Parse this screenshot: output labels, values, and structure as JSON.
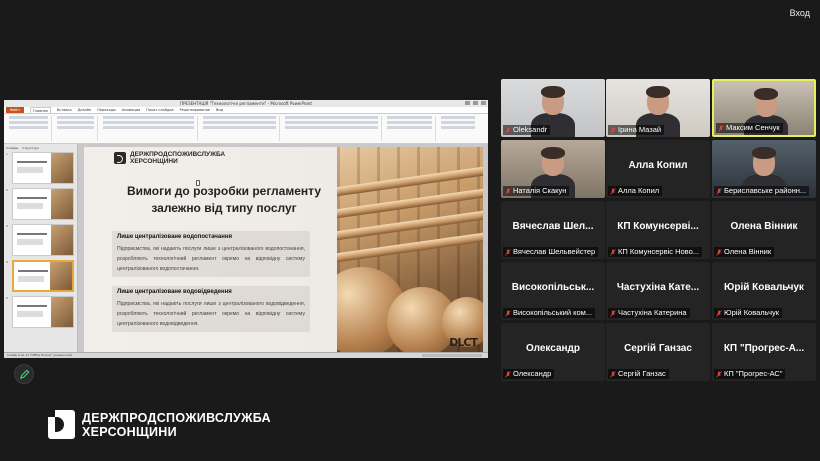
{
  "header": {
    "exit_label": "Вход"
  },
  "powerpoint": {
    "title": "ПРЕЗЕНТАЦІЯ \"Технологічні регламенти\" - Microsoft PowerPoint",
    "tabs": [
      "Файл",
      "Главная",
      "Вставка",
      "Дизайн",
      "Переходы",
      "Анимация",
      "Показ слайдов",
      "Рецензирование",
      "Вид"
    ],
    "thumb_tabs": [
      "Слайды",
      "Структура"
    ],
    "status": "Слайд 4 из 11  \"Office theme\"  украинский"
  },
  "slide": {
    "org_name_line1": "ДЕРЖПРОДСПОЖИВСЛУЖБА",
    "org_name_line2": "ХЕРСОНЩИНИ",
    "title": "Вимоги до розробки регламенту залежно від типу послуг",
    "cards": [
      {
        "heading": "Лише централізоване водопостачання",
        "text": "Підприємства, які надають послуги лише з централізованого водопостачання, розробляють технологічний регламент окремо на відповідну систему централізованого водопостачання."
      },
      {
        "heading": "Лише централізоване водовідведення",
        "text": "Підприємства, які надають послуги лише з централізованого водовідведення, розробляють технологічний регламент окремо на відповідну систему централізованого водовідведення."
      }
    ],
    "watermark": "DLCT"
  },
  "brand": {
    "line1": "ДЕРЖПРОДСПОЖИВСЛУЖБА",
    "line2": "ХЕРСОНЩИНИ"
  },
  "participants": [
    {
      "label": "Oleksandr",
      "big": "",
      "video": true
    },
    {
      "label": "Ірина Мазай",
      "big": "",
      "video": true
    },
    {
      "label": "Максим Сенчук",
      "big": "",
      "video": true,
      "speaking": true
    },
    {
      "label": "Наталія Скакун",
      "big": "",
      "video": true
    },
    {
      "label": "Алла Копил",
      "big": "Алла Копил",
      "video": false
    },
    {
      "label": "Бериславське районн...",
      "big": "",
      "video": true
    },
    {
      "label": "Вячеслав Шельвейстер",
      "big": "Вячеслав Шел...",
      "video": false
    },
    {
      "label": "КП Комунсервіс Ново...",
      "big": "КП Комунсерві...",
      "video": false
    },
    {
      "label": "Олена Вінник",
      "big": "Олена Вінник",
      "video": false
    },
    {
      "label": "Високопільський ком...",
      "big": "Високопільськ...",
      "video": false
    },
    {
      "label": "Частухіна Катерина",
      "big": "Частухіна Кате...",
      "video": false
    },
    {
      "label": "Юрій Ковальчук",
      "big": "Юрій Ковальчук",
      "video": false
    },
    {
      "label": "Олександр",
      "big": "Олександр",
      "video": false
    },
    {
      "label": "Сергій Ганзас",
      "big": "Сергій Ганзас",
      "video": false
    },
    {
      "label": "КП \"Прогрес-АС\"",
      "big": "КП \"Прогрес-А...",
      "video": false
    }
  ],
  "colors": {
    "speaking_border": "#e8ef5b",
    "muted_mic": "#e0443a",
    "background": "#1a1a1a"
  }
}
